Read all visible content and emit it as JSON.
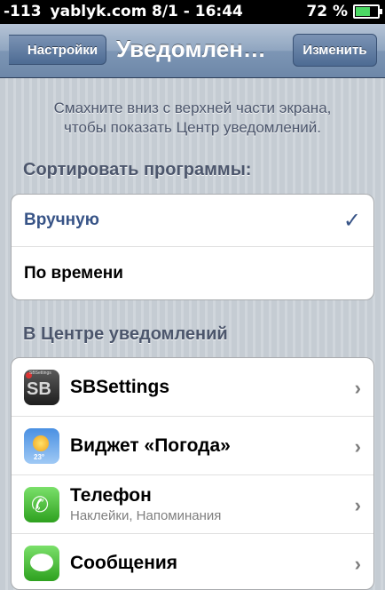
{
  "status": {
    "signal": "-113",
    "carrier": "yablyk.com",
    "time": "8/1 - 16:44",
    "battery": "72 %",
    "battery_level": 0.72
  },
  "nav": {
    "back_label": "Настройки",
    "title": "Уведомлен…",
    "edit_label": "Изменить"
  },
  "info_lines": [
    "Смахните вниз с верхней части экрана,",
    "чтобы показать Центр уведомлений."
  ],
  "sort_section": {
    "header": "Сортировать программы:",
    "options": [
      {
        "label": "Вручную",
        "selected": true
      },
      {
        "label": "По времени",
        "selected": false
      }
    ]
  },
  "center_section": {
    "header": "В Центре уведомлений",
    "apps": [
      {
        "name": "SBSettings",
        "subtitle": "",
        "icon": "sbsettings-icon",
        "icon_text": "SB",
        "icon_top": "SBSettings"
      },
      {
        "name": "Виджет «Погода»",
        "subtitle": "",
        "icon": "weather-icon",
        "icon_text": "23°"
      },
      {
        "name": "Телефон",
        "subtitle": "Наклейки, Напоминания",
        "icon": "phone-icon"
      },
      {
        "name": "Сообщения",
        "subtitle": "",
        "icon": "messages-icon"
      }
    ]
  },
  "colors": {
    "selected_text": "#385487",
    "nav_bar": "#7d96b5",
    "background": "#cbd2d8"
  }
}
